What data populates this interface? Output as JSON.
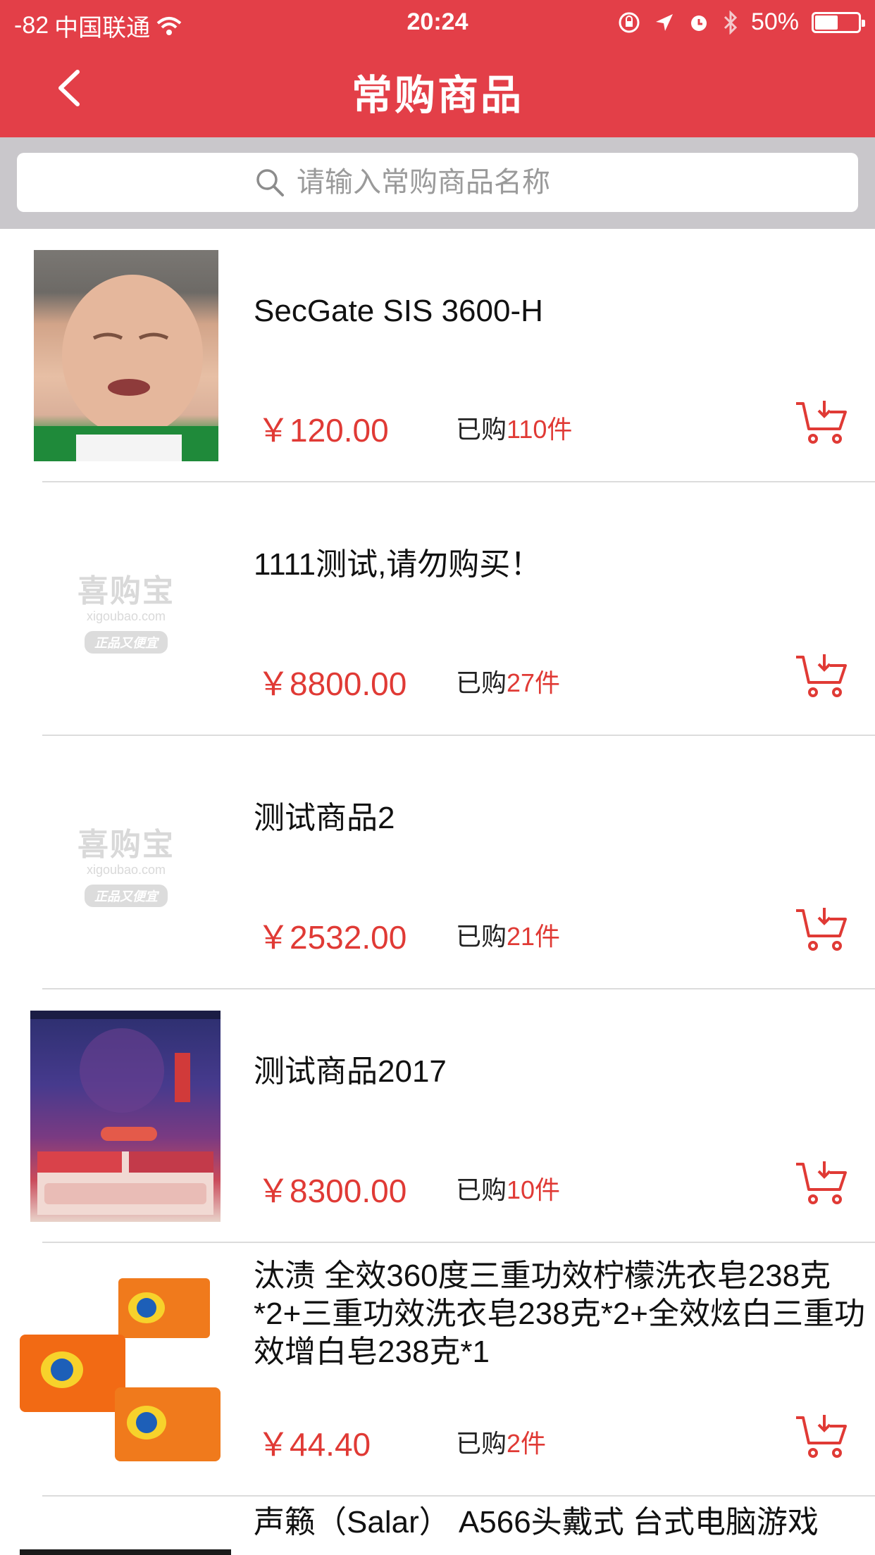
{
  "status_bar": {
    "signal": "-82",
    "carrier": "中国联通",
    "time": "20:24",
    "battery": "50%"
  },
  "nav": {
    "title": "常购商品"
  },
  "search": {
    "placeholder": "请输入常购商品名称"
  },
  "watermark": {
    "brand": "喜购宝",
    "domain": "xigoubao.com",
    "tag": "正品又便宜"
  },
  "items": [
    {
      "name": "SecGate SIS 3600-H",
      "price": "￥120.00",
      "bought_label": "已购",
      "bought_count": "110件",
      "image_icon": "baby-photo"
    },
    {
      "name": "1111测试,请勿购买！",
      "price": "￥8800.00",
      "bought_label": "已购",
      "bought_count": "27件",
      "image_icon": "placeholder-logo"
    },
    {
      "name": "测试商品2",
      "price": "￥2532.00",
      "bought_label": "已购",
      "bought_count": "21件",
      "image_icon": "placeholder-logo"
    },
    {
      "name": "测试商品2017",
      "price": "￥8300.00",
      "bought_label": "已购",
      "bought_count": "10件",
      "image_icon": "new-year-poster"
    },
    {
      "name": "汰渍 全效360度三重功效柠檬洗衣皂238克*2+三重功效洗衣皂238克*2+全效炫白三重功效增白皂238克*1",
      "price": "￥44.40",
      "bought_label": "已购",
      "bought_count": "2件",
      "image_icon": "tide-soap"
    },
    {
      "name": "声籁（Salar） A566头戴式 台式电脑游戏",
      "image_icon": "headset-photo"
    }
  ],
  "colors": {
    "header": "#e33f48",
    "price": "#e03a35"
  }
}
